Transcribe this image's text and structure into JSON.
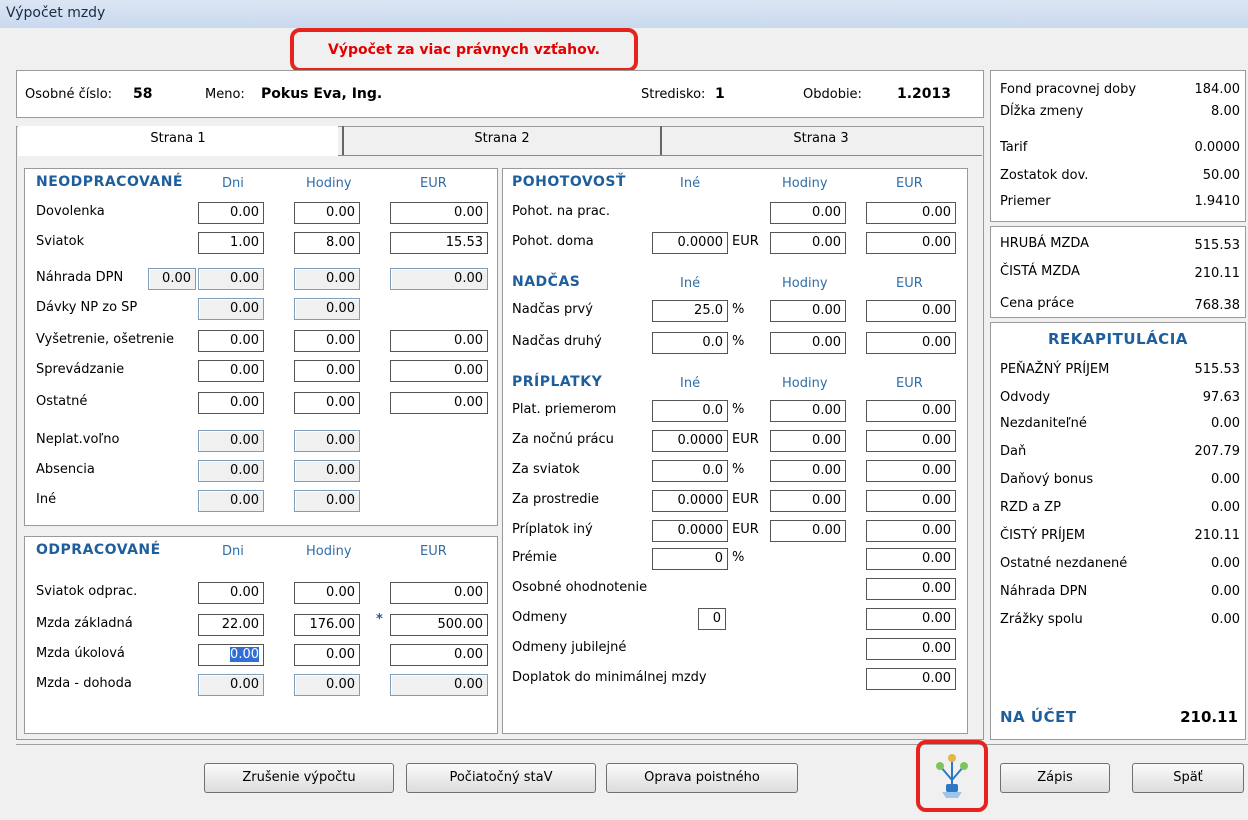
{
  "window": {
    "title": "Výpočet mzdy"
  },
  "banner": "Výpočet za viac právnych vzťahov.",
  "header": {
    "osobne_label": "Osobné číslo:",
    "osobne_value": "58",
    "meno_label": "Meno:",
    "meno_value": "Pokus Eva, Ing.",
    "stredisko_label": "Stredisko:",
    "stredisko_value": "1",
    "obdobie_label": "Obdobie:",
    "obdobie_value": "1.2013"
  },
  "tabs": [
    "Strana 1",
    "Strana 2",
    "Strana 3"
  ],
  "neodpracovane": {
    "title": "NEODPRACOVANÉ",
    "col_dni": "Dni",
    "col_hodiny": "Hodiny",
    "col_eur": "EUR",
    "rows": [
      {
        "label": "Dovolenka",
        "dni": "0.00",
        "hodiny": "0.00",
        "eur": "0.00"
      },
      {
        "label": "Sviatok",
        "dni": "1.00",
        "hodiny": "8.00",
        "eur": "15.53"
      },
      {
        "label": "Náhrada DPN",
        "extra": "0.00",
        "dni": "0.00",
        "hodiny": "0.00",
        "eur": "0.00"
      },
      {
        "label": "Dávky NP zo SP",
        "dni": "0.00",
        "hodiny": "0.00"
      },
      {
        "label": "Vyšetrenie, ošetrenie",
        "dni": "0.00",
        "hodiny": "0.00",
        "eur": "0.00"
      },
      {
        "label": "Sprevádzanie",
        "dni": "0.00",
        "hodiny": "0.00",
        "eur": "0.00"
      },
      {
        "label": "Ostatné",
        "dni": "0.00",
        "hodiny": "0.00",
        "eur": "0.00"
      },
      {
        "label": "Neplat.voľno",
        "dni": "0.00",
        "hodiny": "0.00"
      },
      {
        "label": "Absencia",
        "dni": "0.00",
        "hodiny": "0.00"
      },
      {
        "label": "Iné",
        "dni": "0.00",
        "hodiny": "0.00"
      }
    ]
  },
  "odpracovane": {
    "title": "ODPRACOVANÉ",
    "col_dni": "Dni",
    "col_hodiny": "Hodiny",
    "col_eur": "EUR",
    "star": "*",
    "rows": [
      {
        "label": "Sviatok odprac.",
        "dni": "0.00",
        "hodiny": "0.00",
        "eur": "0.00"
      },
      {
        "label": "Mzda základná",
        "dni": "22.00",
        "hodiny": "176.00",
        "eur": "500.00"
      },
      {
        "label": "Mzda úkolová",
        "dni": "0.00",
        "hodiny": "0.00",
        "eur": "0.00"
      },
      {
        "label": "Mzda - dohoda",
        "dni": "0.00",
        "hodiny": "0.00",
        "eur": "0.00"
      }
    ]
  },
  "pohotovost": {
    "title": "POHOTOVOSŤ",
    "col_ine": "Iné",
    "col_hodiny": "Hodiny",
    "col_eur": "EUR",
    "rows": [
      {
        "label": "Pohot. na prac.",
        "hodiny": "0.00",
        "eur": "0.00"
      },
      {
        "label": "Pohot. doma",
        "ine": "0.0000",
        "unit": "EUR",
        "hodiny": "0.00",
        "eur": "0.00"
      }
    ]
  },
  "nadcas": {
    "title": "NADČAS",
    "col_ine": "Iné",
    "col_hodiny": "Hodiny",
    "col_eur": "EUR",
    "rows": [
      {
        "label": "Nadčas prvý",
        "ine": "25.0",
        "unit": "%",
        "hodiny": "0.00",
        "eur": "0.00"
      },
      {
        "label": "Nadčas druhý",
        "ine": "0.0",
        "unit": "%",
        "hodiny": "0.00",
        "eur": "0.00"
      }
    ]
  },
  "priplatky": {
    "title": "PRÍPLATKY",
    "col_ine": "Iné",
    "col_hodiny": "Hodiny",
    "col_eur": "EUR",
    "rows": [
      {
        "label": "Plat. priemerom",
        "ine": "0.0",
        "unit": "%",
        "hodiny": "0.00",
        "eur": "0.00"
      },
      {
        "label": "Za nočnú prácu",
        "ine": "0.0000",
        "unit": "EUR",
        "hodiny": "0.00",
        "eur": "0.00"
      },
      {
        "label": "Za sviatok",
        "ine": "0.0",
        "unit": "%",
        "hodiny": "0.00",
        "eur": "0.00"
      },
      {
        "label": "Za prostredie",
        "ine": "0.0000",
        "unit": "EUR",
        "hodiny": "0.00",
        "eur": "0.00"
      },
      {
        "label": "Príplatok iný",
        "ine": "0.0000",
        "unit": "EUR",
        "hodiny": "0.00",
        "eur": "0.00"
      },
      {
        "label": "Prémie",
        "ine": "0",
        "unit": "%",
        "eur": "0.00"
      },
      {
        "label": "Osobné ohodnotenie",
        "eur": "0.00"
      },
      {
        "label": "Odmeny",
        "ine": "0",
        "eur": "0.00"
      },
      {
        "label": "Odmeny jubilejné",
        "eur": "0.00"
      },
      {
        "label": "Doplatok do minimálnej mzdy",
        "eur": "0.00"
      }
    ]
  },
  "summary_top": [
    {
      "label": "Fond pracovnej doby",
      "value": "184.00"
    },
    {
      "label": "Dĺžka zmeny",
      "value": "8.00"
    },
    {
      "label": "Tarif",
      "value": "0.0000"
    },
    {
      "label": "Zostatok dov.",
      "value": "50.00"
    },
    {
      "label": "Priemer",
      "value": "1.9410"
    }
  ],
  "summary_mid": [
    {
      "label": "HRUBÁ MZDA",
      "value": "515.53"
    },
    {
      "label": "ČISTÁ MZDA",
      "value": "210.11"
    },
    {
      "label": "Cena práce",
      "value": "768.38"
    }
  ],
  "rekap": {
    "title": "REKAPITULÁCIA",
    "rows": [
      {
        "label": "PEŇAŽNÝ PRÍJEM",
        "value": "515.53"
      },
      {
        "label": "Odvody",
        "value": "97.63"
      },
      {
        "label": "Nezdaniteľné",
        "value": "0.00"
      },
      {
        "label": "Daň",
        "value": "207.79"
      },
      {
        "label": "Daňový bonus",
        "value": "0.00"
      },
      {
        "label": "RZD a ZP",
        "value": "0.00"
      },
      {
        "label": "ČISTÝ PRÍJEM",
        "value": "210.11"
      },
      {
        "label": "Ostatné nezdanené",
        "value": "0.00"
      },
      {
        "label": "Náhrada DPN",
        "value": "0.00"
      },
      {
        "label": "Zrážky spolu",
        "value": "0.00"
      }
    ],
    "na_ucet_label": "NA ÚČET",
    "na_ucet_value": "210.11"
  },
  "buttons": {
    "zrusenie": "Zrušenie výpočtu",
    "pociatocny": "Počiatočný staV",
    "oprava": "Oprava poistného",
    "zapis": "Zápis",
    "spat": "Späť"
  },
  "colors": {
    "accent_header": "#1f5e9c",
    "highlight": "#e8231e"
  }
}
